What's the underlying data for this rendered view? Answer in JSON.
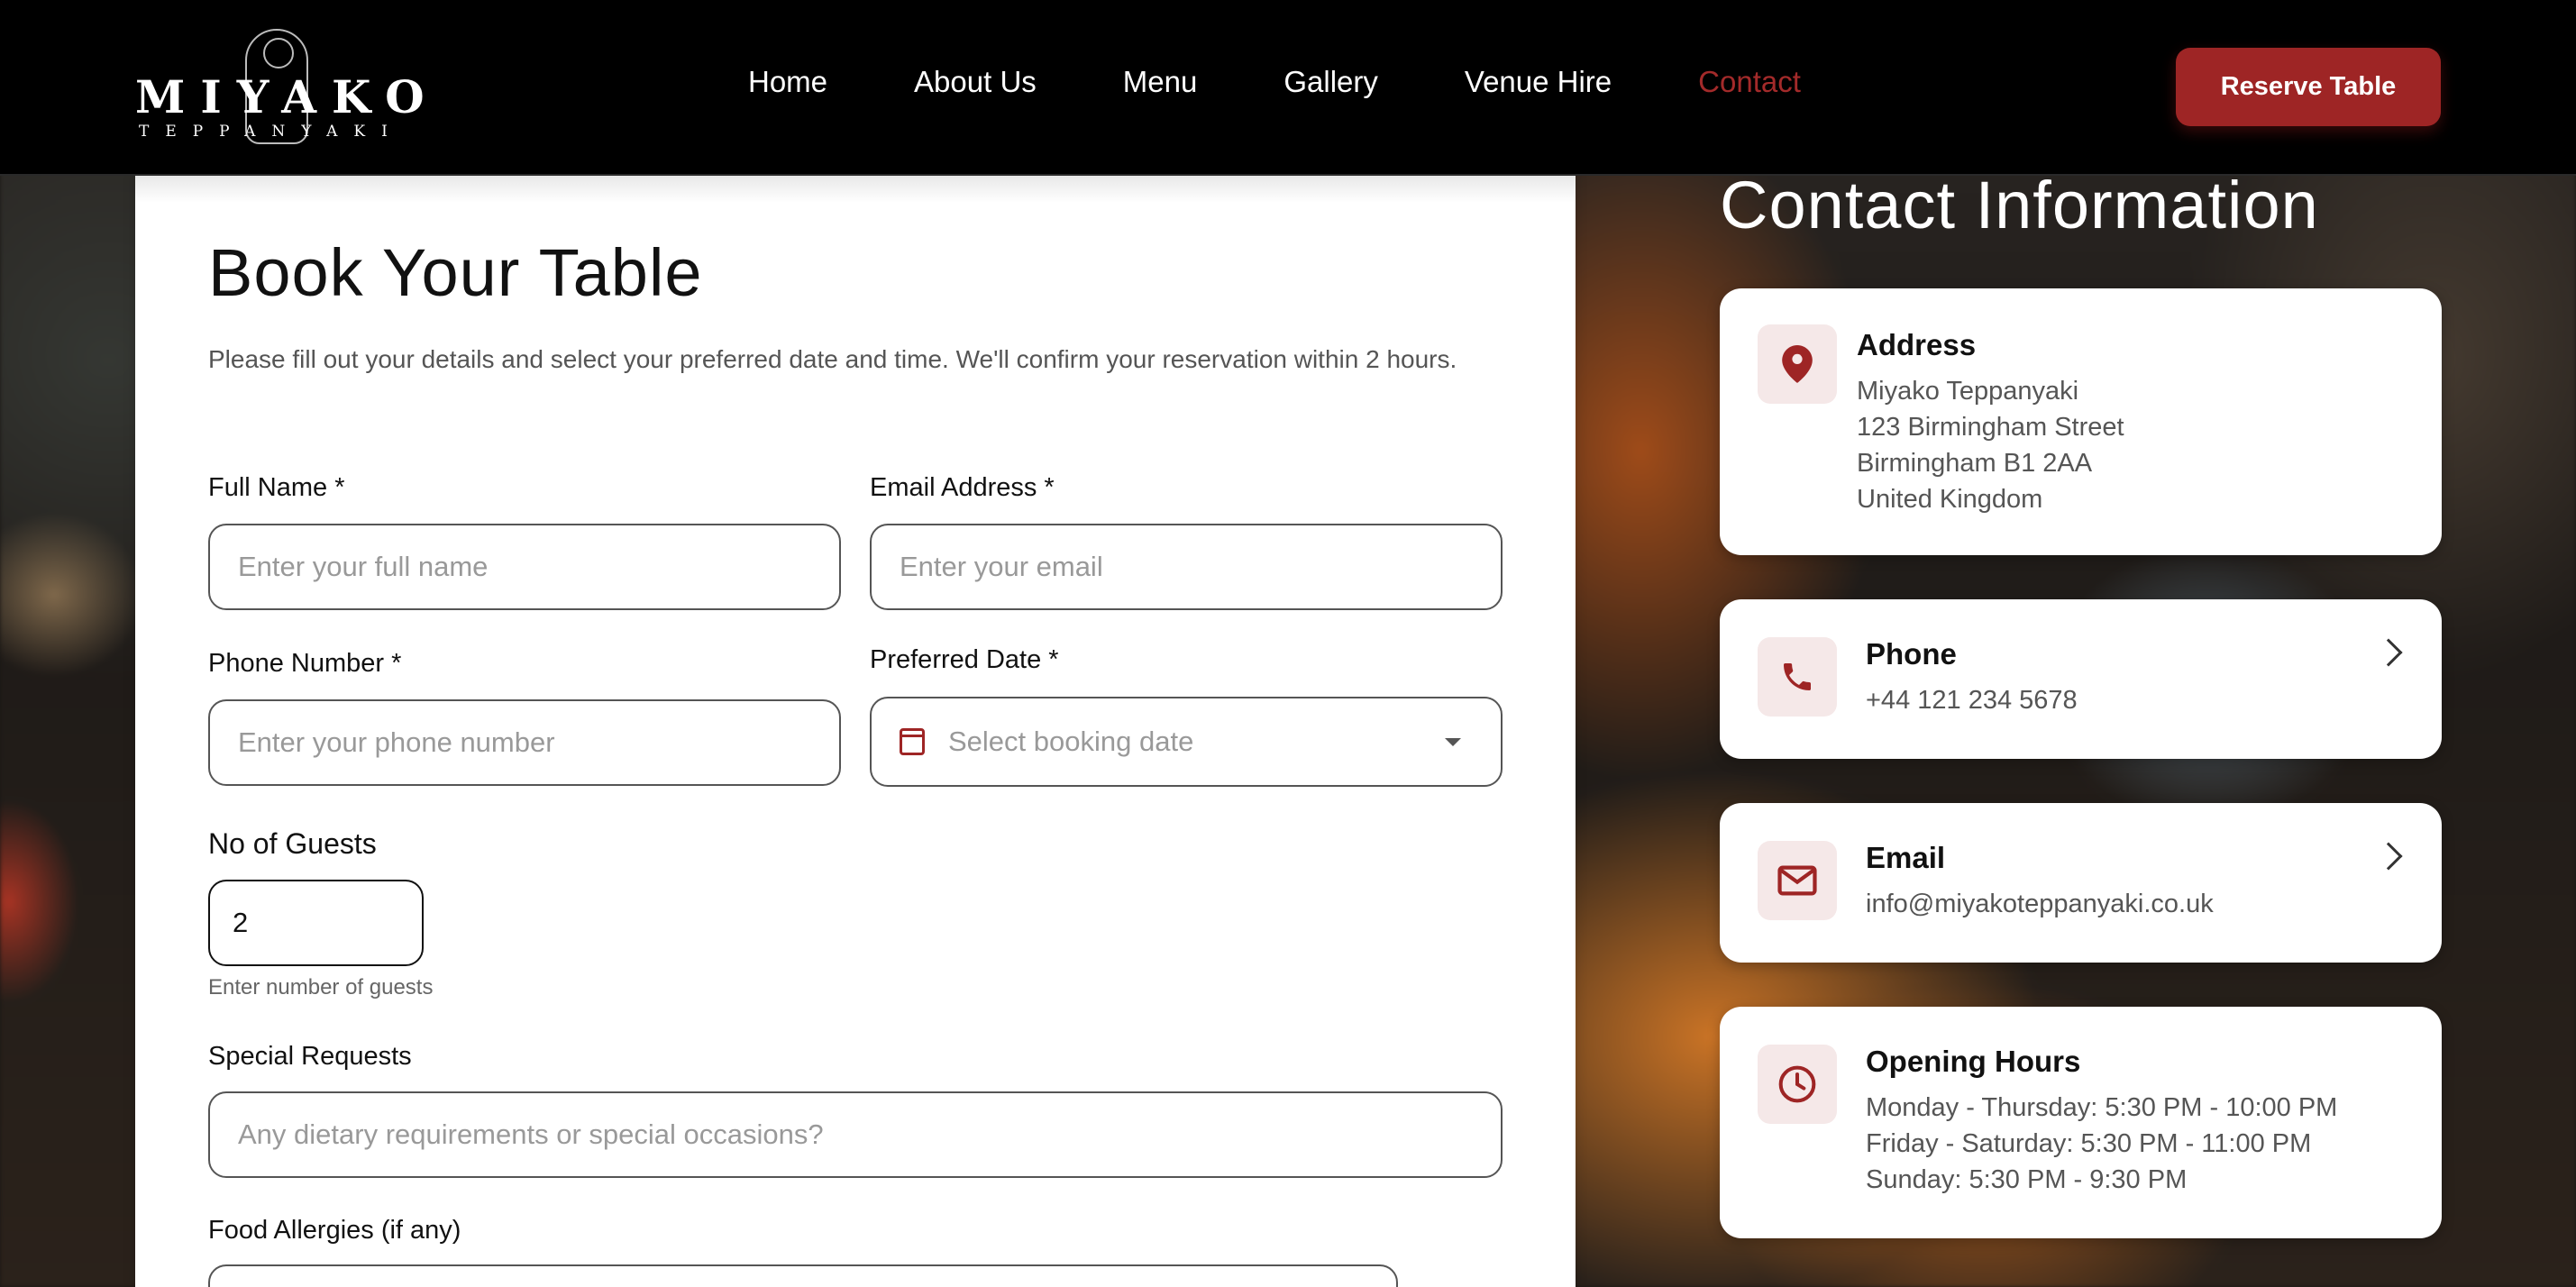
{
  "nav": {
    "logo_word": "MIYAKO",
    "logo_sub": "TEPPANYAKI",
    "items": [
      {
        "label": "Home",
        "active": false
      },
      {
        "label": "About Us",
        "active": false
      },
      {
        "label": "Menu",
        "active": false
      },
      {
        "label": "Gallery",
        "active": false
      },
      {
        "label": "Venue Hire",
        "active": false
      },
      {
        "label": "Contact",
        "active": true
      }
    ],
    "reserve_label": "Reserve Table"
  },
  "form": {
    "title": "Book Your Table",
    "description": "Please fill out your details and select your preferred date and time. We'll confirm your reservation within 2 hours.",
    "full_name": {
      "label": "Full Name *",
      "placeholder": "Enter your full name"
    },
    "email": {
      "label": "Email Address *",
      "placeholder": "Enter your email"
    },
    "phone": {
      "label": "Phone Number *",
      "placeholder": "Enter your phone number"
    },
    "date": {
      "label": "Preferred Date *",
      "placeholder": "Select booking date"
    },
    "guests": {
      "label": "No of Guests",
      "value": "2",
      "hint": "Enter number of guests"
    },
    "special": {
      "label": "Special Requests",
      "placeholder": "Any dietary requirements or special occasions?"
    },
    "allergies": {
      "label": "Food Allergies (if any)"
    }
  },
  "contact": {
    "title": "Contact Information",
    "address": {
      "heading": "Address",
      "lines": [
        "Miyako Teppanyaki",
        "123 Birmingham Street",
        "Birmingham B1 2AA",
        "United Kingdom"
      ]
    },
    "phone": {
      "heading": "Phone",
      "value": "+44 121 234 5678"
    },
    "email": {
      "heading": "Email",
      "value": "info@miyakoteppanyaki.co.uk"
    },
    "hours": {
      "heading": "Opening Hours",
      "lines": [
        "Monday - Thursday: 5:30 PM - 10:00 PM",
        "Friday - Saturday: 5:30 PM - 11:00 PM",
        "Sunday: 5:30 PM - 9:30 PM"
      ]
    }
  },
  "colors": {
    "accent": "#9e2525",
    "nav_bg": "#000000",
    "active_link": "#a32a2a"
  }
}
